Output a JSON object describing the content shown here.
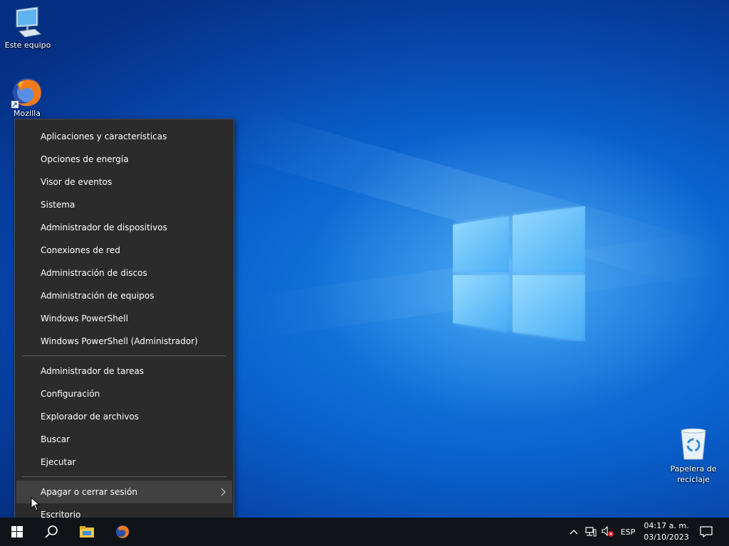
{
  "desktop": {
    "icons": [
      {
        "label": "Este equipo",
        "icon": "computer-icon"
      },
      {
        "label": "Mozilla",
        "icon": "firefox-icon"
      },
      {
        "label": "Papelera de\nreciclaje",
        "icon": "recycle-bin-icon"
      }
    ],
    "colors": {
      "accent": "#0a63cf",
      "menu_bg": "#2b2b2b",
      "taskbar_bg": "#101418"
    }
  },
  "context_menu": {
    "group1": [
      "Aplicaciones y características",
      "Opciones de energía",
      "Visor de eventos",
      "Sistema",
      "Administrador de dispositivos",
      "Conexiones de red",
      "Administración de discos",
      "Administración de equipos",
      "Windows PowerShell",
      "Windows PowerShell (Administrador)"
    ],
    "group2": [
      "Administrador de tareas",
      "Configuración",
      "Explorador de archivos",
      "Buscar",
      "Ejecutar"
    ],
    "group3": [
      "Apagar o cerrar sesión",
      "Escritorio"
    ],
    "hovered_item": "Apagar o cerrar sesión"
  },
  "taskbar": {
    "apps": [
      "start-icon",
      "search-icon",
      "file-explorer-icon",
      "firefox-icon"
    ],
    "tray": {
      "language": "ESP",
      "time": "04:17 a. m.",
      "date": "03/10/2023",
      "icons": [
        "chevron-up-icon",
        "network-icon",
        "volume-muted-icon",
        "notification-icon"
      ]
    }
  }
}
